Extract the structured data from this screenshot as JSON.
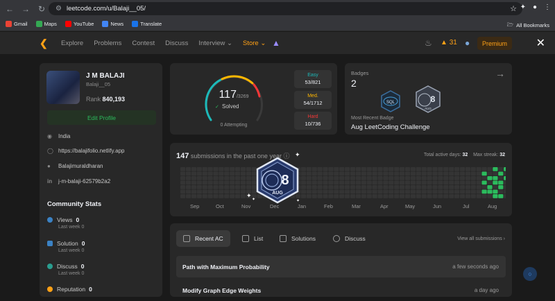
{
  "browser": {
    "url": "leetcode.com/u/Balaji__05/",
    "bookmarks": [
      "Gmail",
      "Maps",
      "YouTube",
      "News",
      "Translate"
    ],
    "all_bookmarks": "All Bookmarks"
  },
  "nav": {
    "links": [
      "Explore",
      "Problems",
      "Contest",
      "Discuss",
      "Interview",
      "Store"
    ],
    "streak": "31",
    "premium": "Premium"
  },
  "profile": {
    "name": "J M BALAJI",
    "username": "Balaji__05",
    "rank_label": "Rank",
    "rank": "840,193",
    "edit": "Edit Profile",
    "location": "India",
    "website": "https://balajifolio.netlify.app",
    "github": "Balajimuraldharan",
    "linkedin": "j-m-balaji-62579b2a2"
  },
  "community": {
    "title": "Community Stats",
    "stats": [
      {
        "label": "Views",
        "value": "0",
        "sub": "Last week 0"
      },
      {
        "label": "Solution",
        "value": "0",
        "sub": "Last week 0"
      },
      {
        "label": "Discuss",
        "value": "0",
        "sub": "Last week 0"
      },
      {
        "label": "Reputation",
        "value": "0"
      }
    ]
  },
  "solved": {
    "count": "117",
    "total": "/3269",
    "label": "Solved",
    "attempting": "0 Attempting",
    "easy": {
      "label": "Easy",
      "value": "53/821",
      "color": "#1cbaba"
    },
    "medium": {
      "label": "Med.",
      "value": "54/1712",
      "color": "#ffb700"
    },
    "hard": {
      "label": "Hard",
      "value": "10/736",
      "color": "#f63737"
    }
  },
  "badges": {
    "title": "Badges",
    "count": "2",
    "badge1": "SQL",
    "badge2_num": "8",
    "badge2_mon": "AUG",
    "recent_label": "Most Recent Badge",
    "recent_name": "Aug LeetCoding Challenge"
  },
  "heatmap": {
    "count": "147",
    "text": "submissions in the past one year",
    "active_label": "Total active days:",
    "active": "32",
    "streak_label": "Max streak:",
    "streak": "32",
    "months": [
      "Sep",
      "Oct",
      "Nov",
      "Dec",
      "Jan",
      "Feb",
      "Mar",
      "Apr",
      "May",
      "Jun",
      "Jul",
      "Aug"
    ]
  },
  "overlay": {
    "num": "8",
    "mon": "AUG"
  },
  "submissions": {
    "tabs": [
      "Recent AC",
      "List",
      "Solutions",
      "Discuss"
    ],
    "view_all": "View all submissions",
    "rows": [
      {
        "title": "Path with Maximum Probability",
        "when": "a few seconds ago"
      },
      {
        "title": "Modify Graph Edge Weights",
        "when": "a day ago"
      }
    ]
  },
  "colors": {
    "accent": "#ffa116",
    "green": "#2cbb5d",
    "bg": "#1a1a1a",
    "card": "#282828"
  }
}
